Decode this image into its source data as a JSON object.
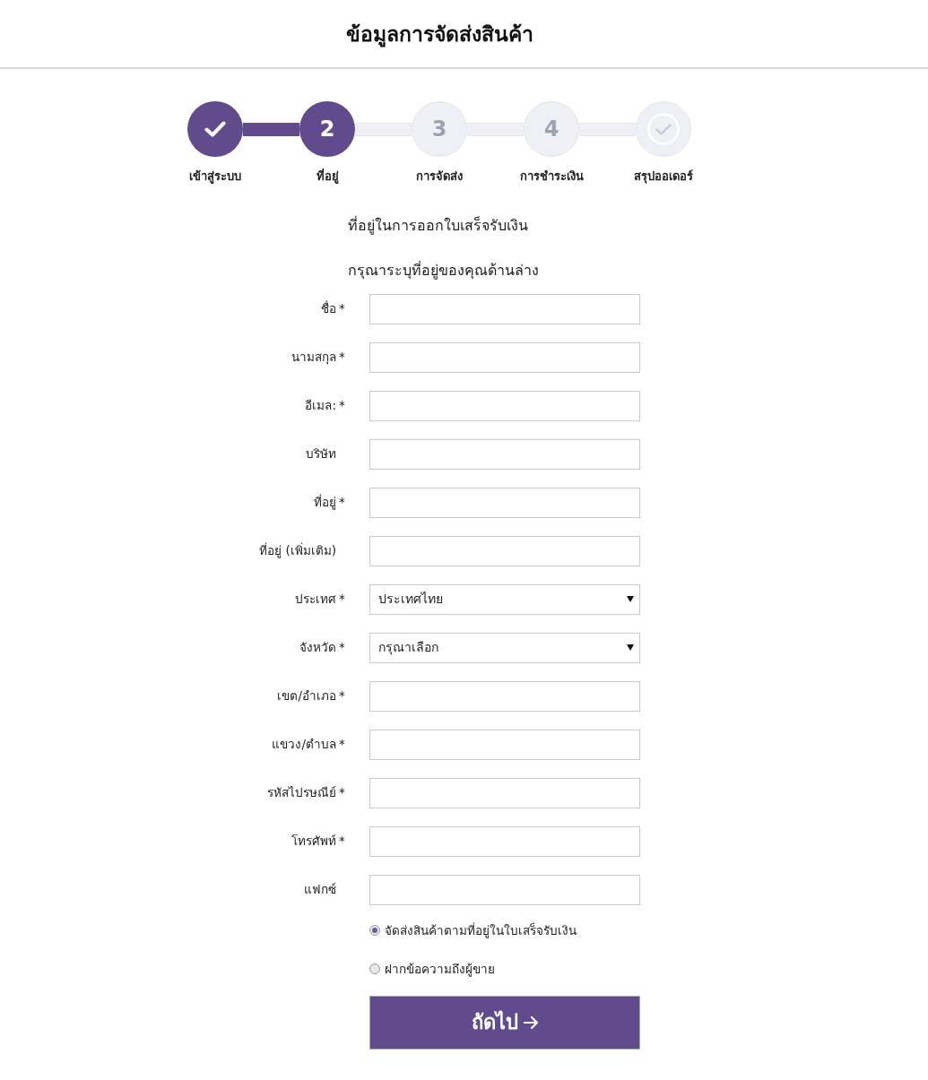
{
  "header": {
    "title": "ข้อมูลการจัดส่งสินค้า"
  },
  "steps": [
    {
      "label": "เข้าสู่ระบบ",
      "kind": "check",
      "reached": true
    },
    {
      "label": "ที่อยู่",
      "kind": "number",
      "number": "2",
      "reached": true
    },
    {
      "label": "การจัดส่ง",
      "kind": "number",
      "number": "3",
      "reached": false
    },
    {
      "label": "การชำระเงิน",
      "kind": "number",
      "number": "4",
      "reached": false
    },
    {
      "label": "สรุปออเดอร์",
      "kind": "check",
      "reached": false
    }
  ],
  "form": {
    "heading": "ที่อยู่ในการออกใบเสร็จรับเงิน",
    "instruction": "กรุณาระบุที่อยู่ของคุณด้านล่าง",
    "fields": [
      {
        "label": "ชื่อ",
        "marker": "*",
        "kind": "text"
      },
      {
        "label": "นามสกุล",
        "marker": "*",
        "kind": "text"
      },
      {
        "label": "อีเมล:",
        "marker": "*",
        "kind": "text"
      },
      {
        "label": "บริษัท",
        "kind": "text"
      },
      {
        "label": "ที่อยู่",
        "marker": "*",
        "kind": "text"
      },
      {
        "label": "ที่อยู่ (เพิ่มเติม)",
        "kind": "text"
      },
      {
        "label": "ประเทศ",
        "marker": "*",
        "kind": "select",
        "value": "ประเทศไทย"
      },
      {
        "label": "จังหวัด",
        "marker": "*",
        "kind": "select",
        "value": "กรุณาเลือก"
      },
      {
        "label": "เขต/อำเภอ",
        "marker": "*",
        "kind": "text"
      },
      {
        "label": "แขวง/ตำบล",
        "marker": "*",
        "kind": "text"
      },
      {
        "label": "รหัสไปรษณีย์",
        "marker": "*",
        "kind": "text"
      },
      {
        "label": "โทรศัพท์",
        "marker": "*",
        "kind": "text"
      },
      {
        "label": "แฟกซ์",
        "kind": "text"
      }
    ],
    "delivery_options": [
      {
        "label": "จัดส่งสินค้าตามที่อยู่ในใบเสร็จรับเงิน",
        "selected": true
      },
      {
        "label": "ฝากข้อความถึงผู้ขาย",
        "selected": false
      }
    ],
    "next_button": {
      "label": "ถัดไป"
    }
  }
}
